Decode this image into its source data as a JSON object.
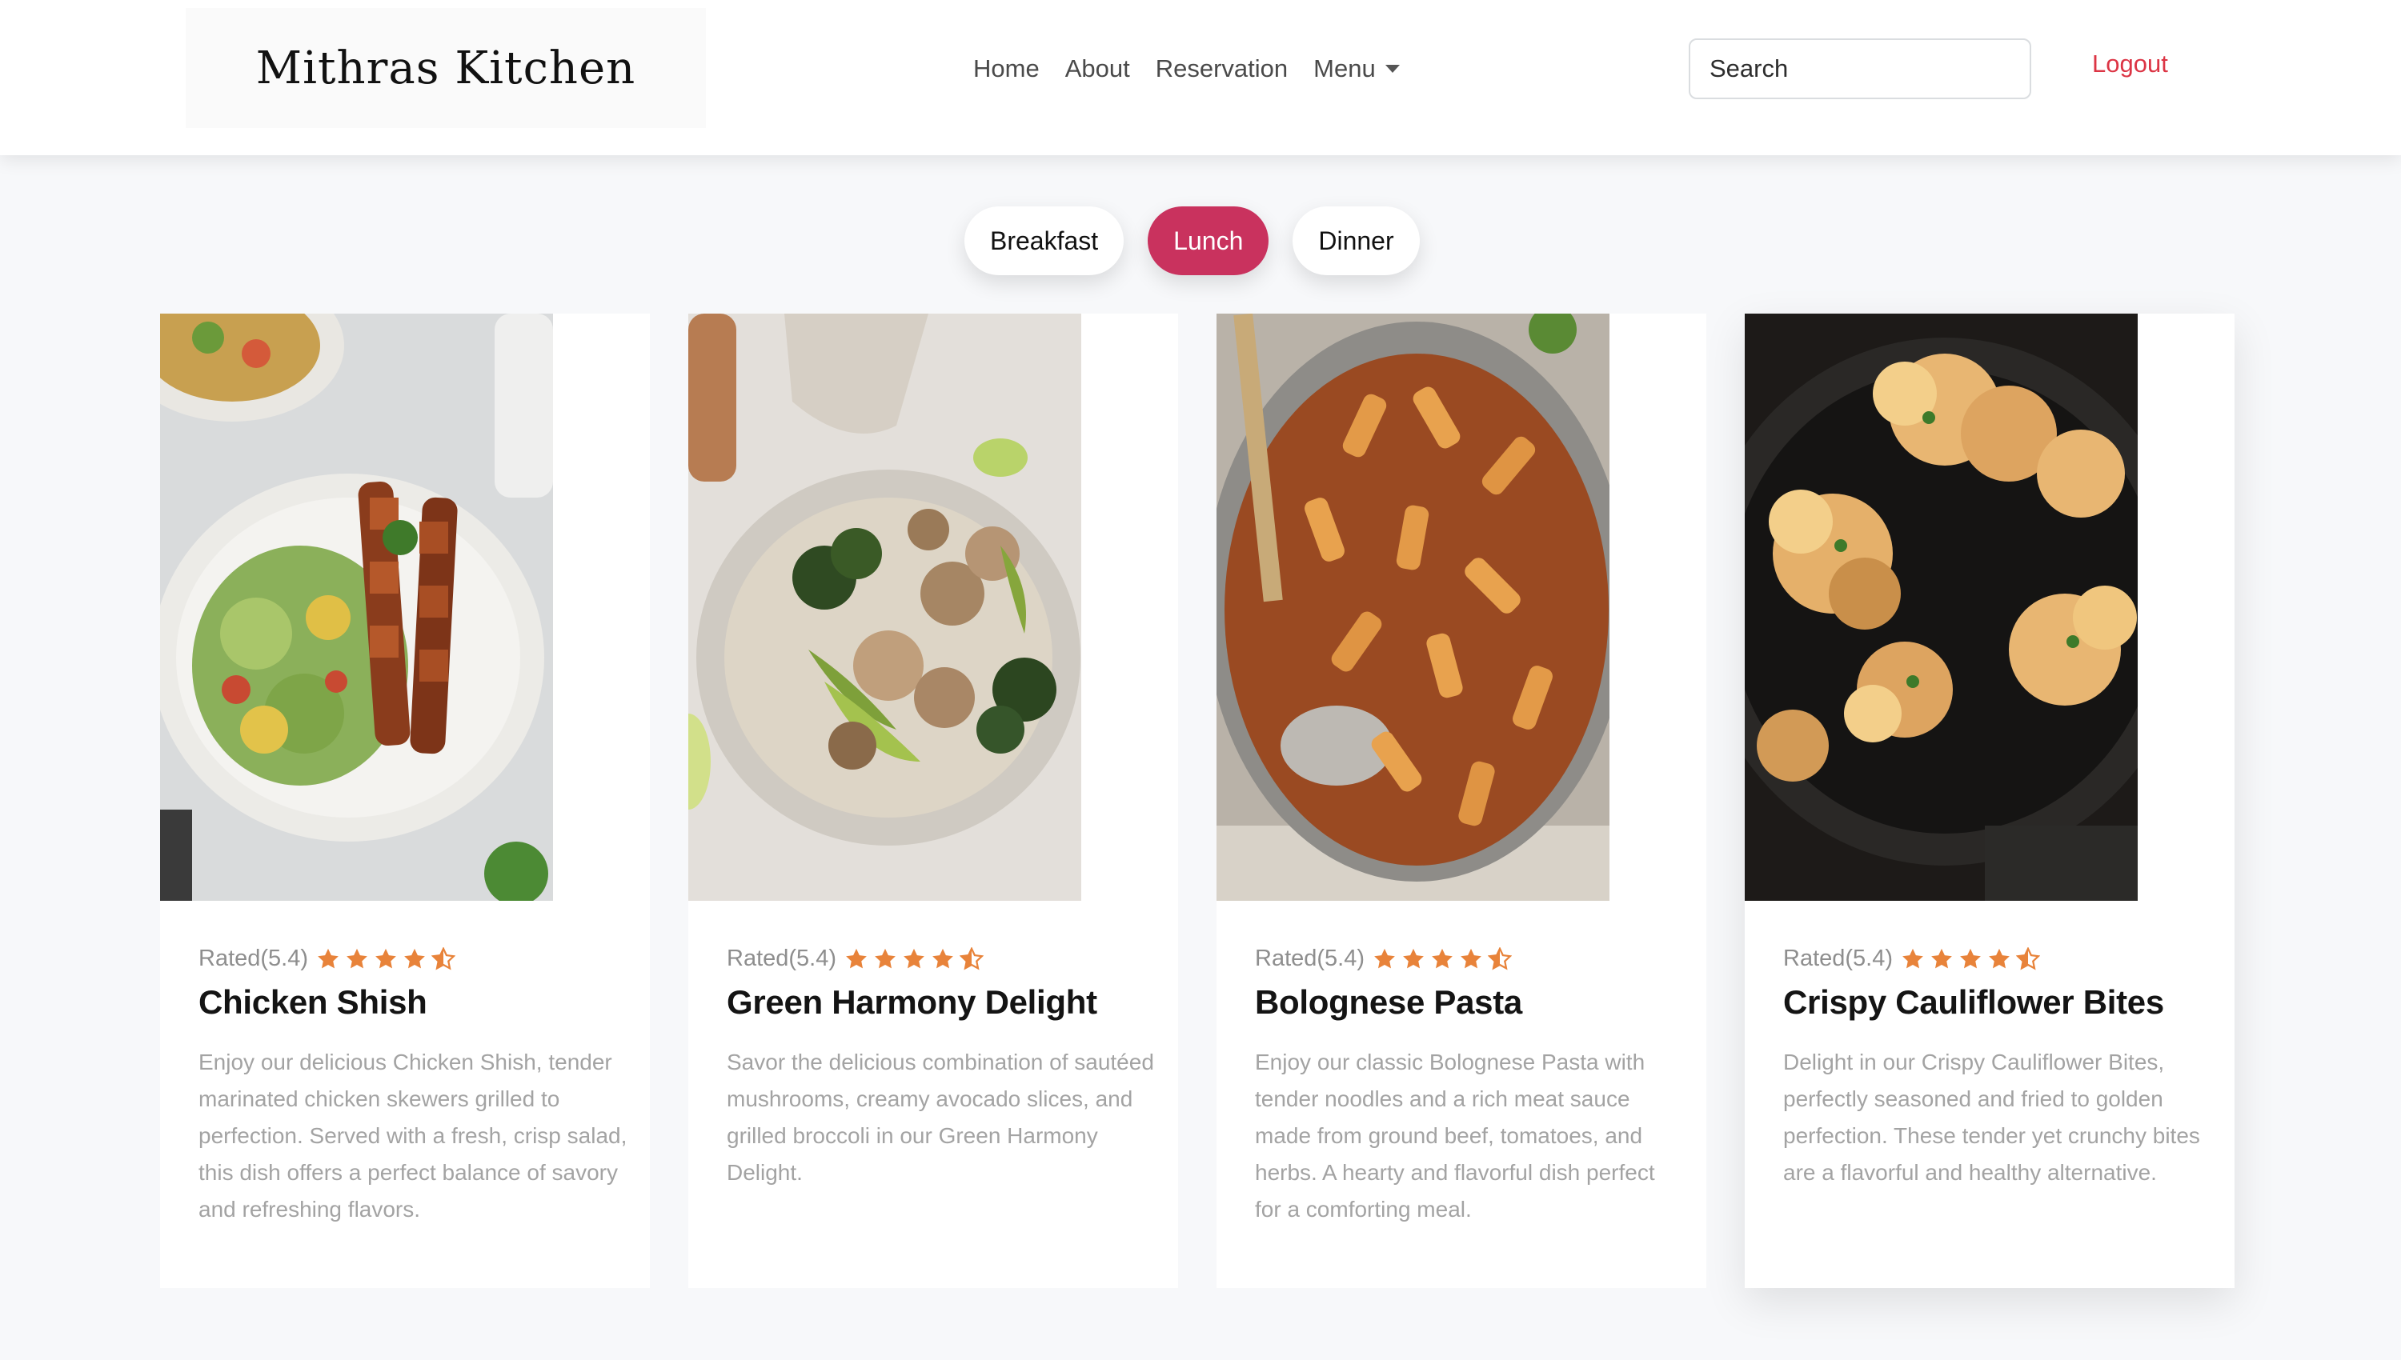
{
  "brand": {
    "name": "Mithras Kitchen"
  },
  "nav": {
    "home": "Home",
    "about": "About",
    "reservation": "Reservation",
    "menu": "Menu"
  },
  "search": {
    "placeholder": "Search"
  },
  "logout": "Logout",
  "tabs": [
    {
      "label": "Breakfast",
      "active": false
    },
    {
      "label": "Lunch",
      "active": true
    },
    {
      "label": "Dinner",
      "active": false
    }
  ],
  "colors": {
    "accent": "#c9325e",
    "logout": "#dc3545",
    "star": "#e8833a"
  },
  "cards": [
    {
      "rating_text": "Rated(5.4)",
      "stars": 4.5,
      "title": "Chicken Shish",
      "description": "Enjoy our delicious Chicken Shish, tender marinated chicken skewers grilled to perfection. Served with a fresh, crisp salad, this dish offers a perfect balance of savory and refreshing flavors.",
      "image": "chicken-shish-salad-photo"
    },
    {
      "rating_text": "Rated(5.4)",
      "stars": 4.5,
      "title": "Green Harmony Delight",
      "description": "Savor the delicious combination of sautéed mushrooms, creamy avocado slices, and grilled broccoli in our Green Harmony Delight.",
      "image": "mushroom-avocado-broccoli-bowl-photo"
    },
    {
      "rating_text": "Rated(5.4)",
      "stars": 4.5,
      "title": "Bolognese Pasta",
      "description": "Enjoy our classic Bolognese Pasta with tender noodles and a rich meat sauce made from ground beef, tomatoes, and herbs. A hearty and flavorful dish perfect for a comforting meal.",
      "image": "bolognese-pasta-pan-photo"
    },
    {
      "rating_text": "Rated(5.4)",
      "stars": 4.5,
      "title": "Crispy Cauliflower Bites",
      "description": "Delight in our Crispy Cauliflower Bites, perfectly seasoned and fried to golden perfection. These tender yet crunchy bites are a flavorful and healthy alternative.",
      "image": "crispy-cauliflower-skillet-photo"
    }
  ]
}
